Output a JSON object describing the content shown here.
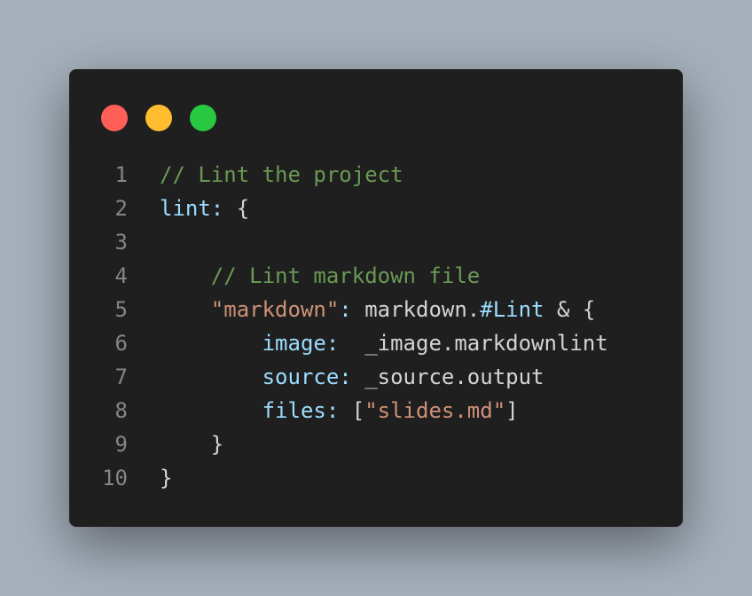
{
  "window": {
    "buttons": [
      "close",
      "minimize",
      "maximize"
    ],
    "colors": {
      "close": "#ff5f57",
      "minimize": "#febc2e",
      "maximize": "#28c840"
    }
  },
  "code": {
    "lines": [
      {
        "number": "1",
        "tokens": [
          {
            "text": "// Lint the project",
            "kind": "comment"
          }
        ]
      },
      {
        "number": "2",
        "tokens": [
          {
            "text": "lint:",
            "kind": "key"
          },
          {
            "text": " {",
            "kind": "plain"
          }
        ]
      },
      {
        "number": "3",
        "tokens": []
      },
      {
        "number": "4",
        "tokens": [
          {
            "text": "    ",
            "kind": "plain"
          },
          {
            "text": "// Lint markdown file",
            "kind": "comment"
          }
        ]
      },
      {
        "number": "5",
        "tokens": [
          {
            "text": "    ",
            "kind": "plain"
          },
          {
            "text": "\"markdown\"",
            "kind": "str"
          },
          {
            "text": ":",
            "kind": "key"
          },
          {
            "text": " markdown.",
            "kind": "plain"
          },
          {
            "text": "#Lint",
            "kind": "key"
          },
          {
            "text": " & {",
            "kind": "plain"
          }
        ]
      },
      {
        "number": "6",
        "tokens": [
          {
            "text": "        ",
            "kind": "plain"
          },
          {
            "text": "image:",
            "kind": "key"
          },
          {
            "text": "  _image.markdownlint",
            "kind": "plain"
          }
        ]
      },
      {
        "number": "7",
        "tokens": [
          {
            "text": "        ",
            "kind": "plain"
          },
          {
            "text": "source:",
            "kind": "key"
          },
          {
            "text": " _source.output",
            "kind": "plain"
          }
        ]
      },
      {
        "number": "8",
        "tokens": [
          {
            "text": "        ",
            "kind": "plain"
          },
          {
            "text": "files:",
            "kind": "key"
          },
          {
            "text": " [",
            "kind": "plain"
          },
          {
            "text": "\"slides.md\"",
            "kind": "str"
          },
          {
            "text": "]",
            "kind": "plain"
          }
        ]
      },
      {
        "number": "9",
        "tokens": [
          {
            "text": "    }",
            "kind": "plain"
          }
        ]
      },
      {
        "number": "10",
        "tokens": [
          {
            "text": "}",
            "kind": "plain"
          }
        ]
      }
    ]
  }
}
